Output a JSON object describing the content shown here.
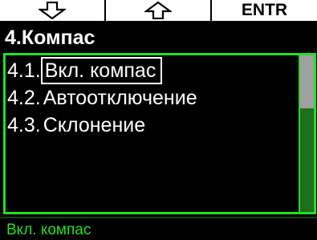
{
  "softkeys": {
    "down": {
      "icon": "arrow-down-outline-icon"
    },
    "up": {
      "icon": "arrow-up-outline-icon"
    },
    "enter": {
      "label": "ENTR"
    }
  },
  "title": "4.Компас",
  "menu": {
    "items": [
      {
        "number": "4.1.",
        "label": "Вкл. компас",
        "selected": true
      },
      {
        "number": "4.2.",
        "label": "Автоотключение",
        "selected": false
      },
      {
        "number": "4.3.",
        "label": "Склонение",
        "selected": false
      }
    ],
    "scroll_position_fraction": 0
  },
  "status": "Вкл. компас",
  "colors": {
    "background": "#000000",
    "accent_green": "#22e022",
    "scroll_track": "#1d6e1d",
    "scroll_thumb": "#a0a0a0",
    "text": "#ffffff"
  }
}
